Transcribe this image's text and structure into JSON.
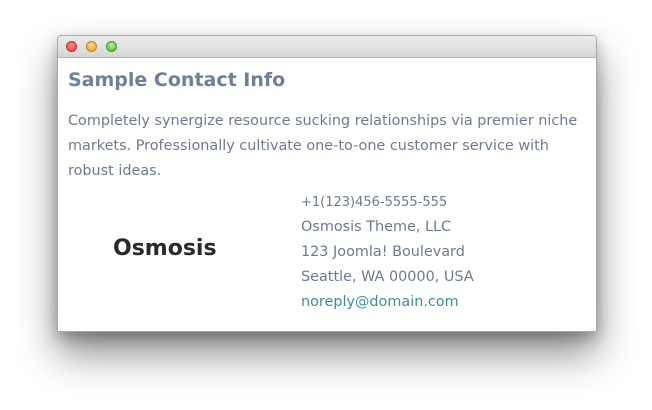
{
  "window": {
    "controls": {
      "close": "close-icon",
      "minimize": "minimize-icon",
      "zoom": "zoom-icon"
    }
  },
  "contact": {
    "heading": "Sample Contact Info",
    "intro": "Completely synergize resource sucking relationships via premier niche markets. Professionally cultivate one-to-one customer service with robust ideas.",
    "logo_text": "Osmosis",
    "phone": "+1(123)456-5555-555",
    "company": "Osmosis Theme, LLC",
    "street": "123 Joomla! Boulevard",
    "city": "Seattle, WA 00000, USA",
    "email": "noreply@domain.com"
  },
  "colors": {
    "heading": "#6f7f9a",
    "body_text": "#6d7b92",
    "link": "#3f8e93",
    "logo": "#2a2a2a"
  }
}
